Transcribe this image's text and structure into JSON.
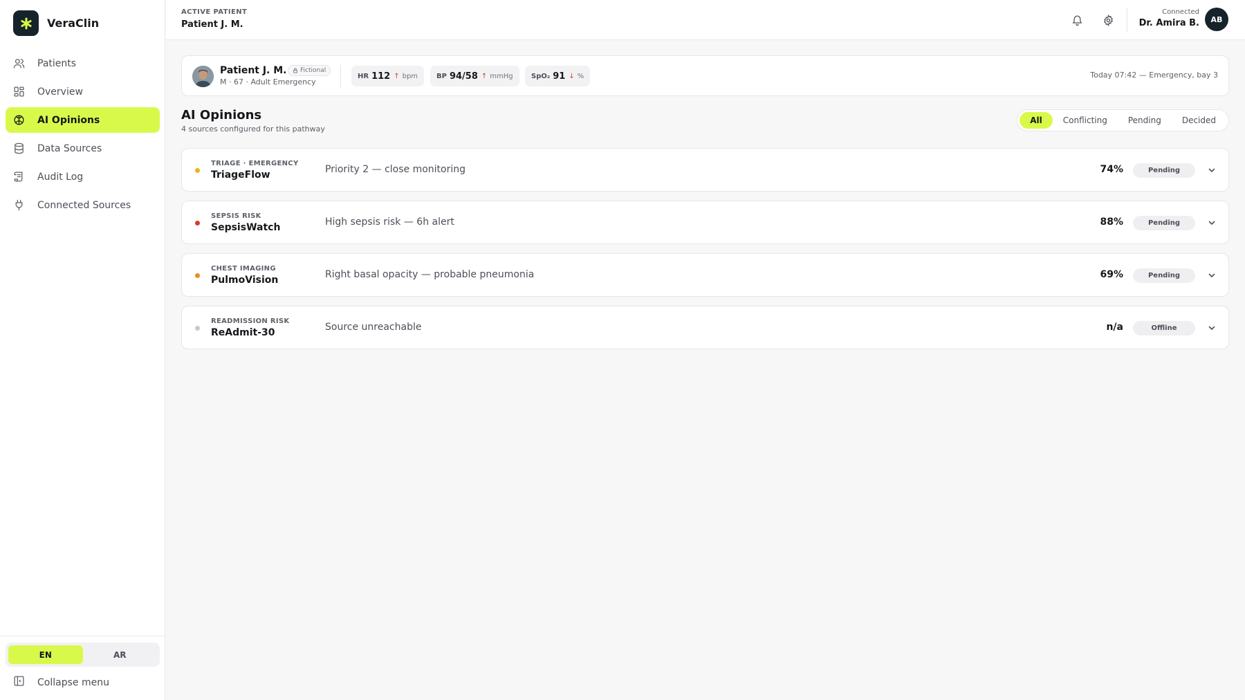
{
  "brand": {
    "name": "VeraClin",
    "logo_icon": "asterisk-icon"
  },
  "sidebar": {
    "items": [
      {
        "label": "Patients",
        "icon": "users-icon"
      },
      {
        "label": "Overview",
        "icon": "dashboard-icon"
      },
      {
        "label": "AI Opinions",
        "icon": "brain-icon",
        "active": true
      },
      {
        "label": "Data Sources",
        "icon": "database-icon"
      },
      {
        "label": "Audit Log",
        "icon": "scroll-icon"
      },
      {
        "label": "Connected Sources",
        "icon": "plug-icon"
      }
    ],
    "languages": [
      "EN",
      "AR"
    ],
    "active_language": "EN",
    "collapse_label": "Collapse menu"
  },
  "header": {
    "active_label": "ACTIVE PATIENT",
    "active_name": "Patient J. M.",
    "user_status": "Connected",
    "user_name": "Dr. Amira B.",
    "user_initials": "AB"
  },
  "patient": {
    "name": "Patient J. M.",
    "tag": "Fictional",
    "meta": "M · 67 · Adult Emergency",
    "vitals": [
      {
        "label": "HR",
        "value": "112",
        "arrow": "↑",
        "unit": "bpm",
        "trend": "up"
      },
      {
        "label": "BP",
        "value": "94/58",
        "arrow": "↑",
        "unit": "mmHg",
        "trend": "up"
      },
      {
        "label": "SpO₂",
        "value": "91",
        "arrow": "↓",
        "unit": "%",
        "trend": "down"
      }
    ],
    "context": "Today 07:42 — Emergency, bay 3"
  },
  "section": {
    "title": "AI Opinions",
    "subtitle": "4 sources configured for this pathway",
    "filters": [
      "All",
      "Conflicting",
      "Pending",
      "Decided"
    ],
    "active_filter": "All"
  },
  "opinions": [
    {
      "category": "TRIAGE · EMERGENCY",
      "name": "TriageFlow",
      "summary": "Priority 2 — close monitoring",
      "score": "74%",
      "status": "Pending",
      "dot_color": "#f2b01e"
    },
    {
      "category": "SEPSIS RISK",
      "name": "SepsisWatch",
      "summary": "High sepsis risk — 6h alert",
      "score": "88%",
      "status": "Pending",
      "dot_color": "#d93a2b"
    },
    {
      "category": "CHEST IMAGING",
      "name": "PulmoVision",
      "summary": "Right basal opacity — probable pneumonia",
      "score": "69%",
      "status": "Pending",
      "dot_color": "#e8901a"
    },
    {
      "category": "READMISSION RISK",
      "name": "ReAdmit-30",
      "summary": "Source unreachable",
      "score": "n/a",
      "status": "Offline",
      "dot_color": "#c9c9cd"
    }
  ],
  "colors": {
    "accent": "#d9f94a",
    "dark": "#16232b",
    "up": "#d93a2b",
    "down": "#d93a2b"
  }
}
